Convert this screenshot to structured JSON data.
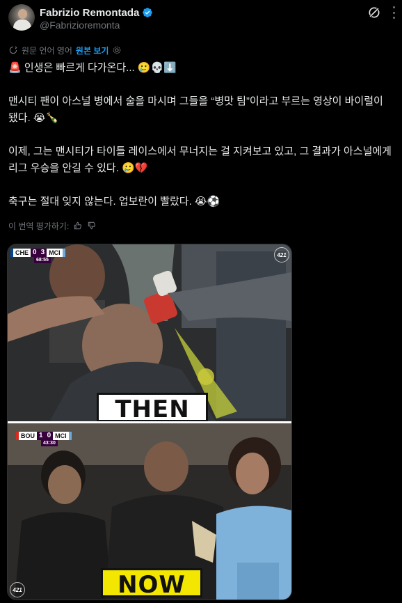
{
  "author": {
    "display_name": "Fabrizio Remontada",
    "handle": "@Fabrizioremonta"
  },
  "translation": {
    "label": "원문 언어 영어",
    "show_original": "원본 보기"
  },
  "tweet": {
    "line1": "🚨 인생은 빠르게 다가온다... 🥲💀⬇️",
    "line2": "맨시티 팬이 아스널 병에서 술을 마시며 그들을 “병맛 팀”이라고 부르는 영상이 바이럴이 됐다. 😭🍾",
    "line3": "이제, 그는 맨시티가 타이틀 레이스에서 무너지는 걸 지켜보고 있고, 그 결과가 아스널에게 리그 우승을 안길 수 있다. 🥲💔",
    "line4": "축구는 절대 잊지 않는다. 업보란이 빨랐다. 😭⚽"
  },
  "rate_translation": {
    "label": "이 번역 평가하기:",
    "like_icon": "thumbs-up-icon",
    "dislike_icon": "thumbs-down-icon"
  },
  "media": {
    "top_panel": {
      "scorebug": {
        "home": "CHE",
        "home_score": "0",
        "away_score": "3",
        "away": "MCI",
        "clock": "68:55"
      },
      "caption": "THEN"
    },
    "bottom_panel": {
      "scorebug": {
        "home": "BOU",
        "home_score": "1",
        "away_score": "0",
        "away": "MCI",
        "clock": "43:30"
      },
      "caption": "NOW"
    }
  },
  "colors": {
    "background": "#000000",
    "text": "#e7e9ea",
    "muted": "#71767b",
    "accent": "#1d9bf0",
    "now_yellow": "#f3e600"
  }
}
